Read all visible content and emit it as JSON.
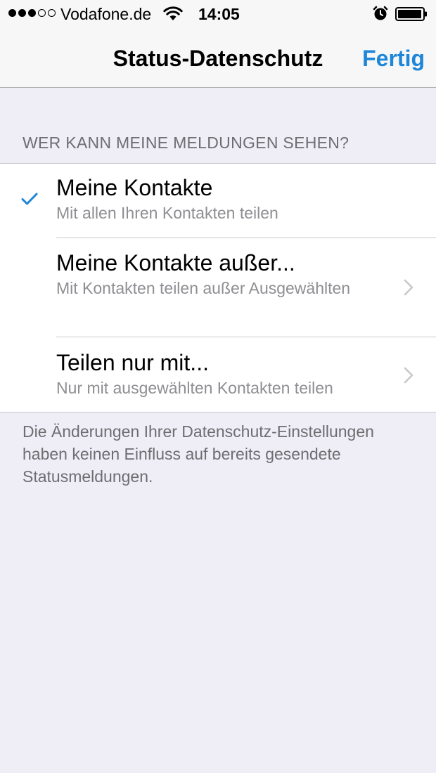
{
  "status_bar": {
    "carrier": "Vodafone.de",
    "time": "14:05",
    "signal_strength": 3,
    "signal_max": 5,
    "icons": [
      "wifi-icon",
      "alarm-icon",
      "battery-icon"
    ],
    "battery_level_percent": 90
  },
  "nav": {
    "title": "Status-Datenschutz",
    "done_label": "Fertig",
    "accent_color": "#1d86d8"
  },
  "section": {
    "header": "WER KANN MEINE MELDUNGEN SEHEN?",
    "options": [
      {
        "title": "Meine Kontakte",
        "subtitle": "Mit allen Ihren Kontakten teilen",
        "selected": true
      },
      {
        "title": "Meine Kontakte außer...",
        "subtitle": "Mit Kontakten teilen außer Ausgewählten",
        "selected": false,
        "has_disclosure": true
      },
      {
        "title": "Teilen nur mit...",
        "subtitle": "Nur mit ausgewählten Kontakten teilen",
        "selected": false,
        "has_disclosure": true
      }
    ],
    "footer": "Die Änderungen Ihrer Datenschutz-Einstellungen haben keinen Einfluss auf bereits gesendete Statusmeldungen."
  }
}
